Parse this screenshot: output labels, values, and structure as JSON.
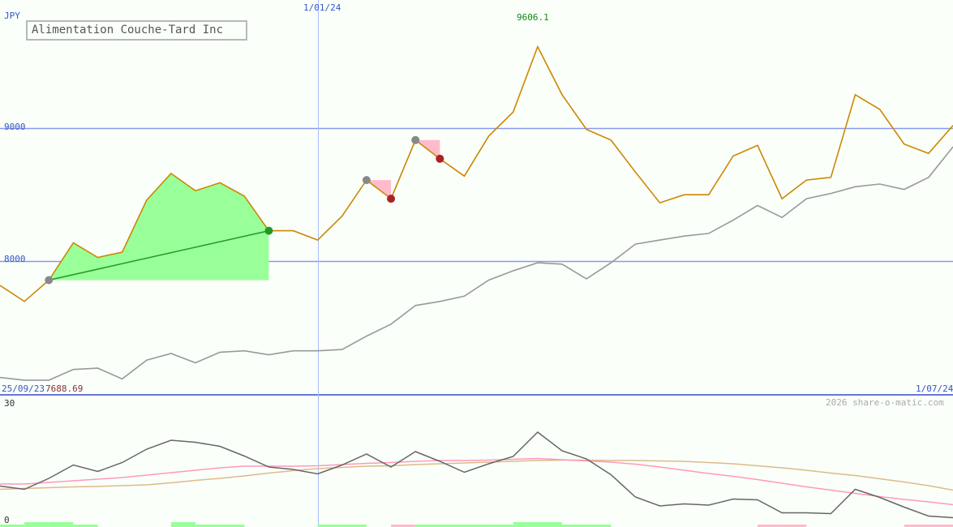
{
  "chart_data": [
    {
      "type": "line",
      "title": "Alimentation Couche-Tard Inc",
      "currency": "JPY",
      "x_start_label": "25/09/23",
      "x_mid_label": "1/01/24",
      "x_end_label": "1/07/24",
      "min_label": "7688.69",
      "max_label": "9606.1",
      "y_ticks": [
        8000,
        9000
      ],
      "ylim": [
        7000,
        9960
      ],
      "series": [
        {
          "color": "#cc8800",
          "values": [
            7820,
            7700,
            7860,
            8140,
            8030,
            8070,
            8460,
            8660,
            8530,
            8590,
            8490,
            8230,
            8230,
            8160,
            8340,
            8610,
            8470,
            8910,
            8770,
            8640,
            8940,
            9120,
            9610,
            9250,
            8990,
            8910,
            8670,
            8440,
            8500,
            8500,
            8790,
            8870,
            8470,
            8610,
            8630,
            9250,
            9140,
            8880,
            8810,
            9020
          ]
        },
        {
          "color": "#999999",
          "values": [
            7130,
            7110,
            7110,
            7190,
            7200,
            7120,
            7260,
            7310,
            7240,
            7320,
            7330,
            7300,
            7330,
            7330,
            7340,
            7440,
            7530,
            7670,
            7700,
            7740,
            7860,
            7930,
            7990,
            7980,
            7870,
            7990,
            8130,
            8160,
            8190,
            8210,
            8310,
            8420,
            8330,
            8470,
            8510,
            8560,
            8580,
            8540,
            8630,
            8860
          ]
        }
      ],
      "signals": [
        {
          "type": "buy",
          "from_index": 2,
          "to_index": 11
        },
        {
          "type": "sell",
          "from_index": 15,
          "to_index": 16
        },
        {
          "type": "sell",
          "from_index": 17,
          "to_index": 18
        }
      ]
    },
    {
      "type": "line",
      "y_ticks": [
        0,
        30
      ],
      "ylim": [
        0,
        30
      ],
      "series": [
        {
          "color": "#666666",
          "values": [
            9.7,
            8.9,
            11.6,
            14.9,
            13.3,
            15.5,
            18.8,
            21.0,
            20.5,
            19.5,
            17.1,
            14.4,
            13.8,
            12.7,
            14.9,
            17.6,
            14.4,
            18.2,
            15.8,
            13.1,
            15.2,
            17.0,
            23.0,
            18.4,
            16.4,
            12.5,
            7.0,
            4.8,
            5.3,
            5.0,
            6.5,
            6.3,
            3.1,
            3.1,
            2.9,
            8.9,
            6.9,
            4.5,
            2.3,
            1.9
          ]
        },
        {
          "color": "#ff99bb",
          "values": [
            10.2,
            10.2,
            10.6,
            11.0,
            11.4,
            11.8,
            12.4,
            13.0,
            13.6,
            14.2,
            14.6,
            14.6,
            14.6,
            14.7,
            15.0,
            15.3,
            15.5,
            15.8,
            16.0,
            16.0,
            16.1,
            16.3,
            16.5,
            16.2,
            15.9,
            15.6,
            15.1,
            14.4,
            13.6,
            12.8,
            12.1,
            11.3,
            10.4,
            9.5,
            8.7,
            7.9,
            7.1,
            6.4,
            5.8,
            5.1
          ]
        },
        {
          "color": "#ddbb88",
          "values": [
            8.9,
            9.1,
            9.3,
            9.5,
            9.6,
            9.8,
            10.0,
            10.5,
            11.1,
            11.6,
            12.2,
            12.9,
            13.5,
            14.0,
            14.3,
            14.6,
            14.7,
            15.0,
            15.2,
            15.4,
            15.6,
            15.8,
            16.0,
            16.1,
            16.1,
            16.0,
            16.0,
            15.9,
            15.8,
            15.5,
            15.2,
            14.7,
            14.2,
            13.6,
            12.9,
            12.3,
            11.5,
            10.7,
            9.8,
            8.7
          ]
        }
      ],
      "bars_positive_color": "#99ff99",
      "bars_negative_color": "#ffbbcc",
      "bars": [
        1,
        2,
        2,
        1,
        0,
        0,
        0,
        2,
        1,
        1,
        0,
        0,
        0,
        1,
        1,
        0,
        -1,
        1,
        1,
        1,
        1,
        2,
        2,
        1,
        1,
        0,
        0,
        0,
        0,
        0,
        0,
        -1,
        -1,
        0,
        0,
        0,
        0,
        -1,
        -1,
        0
      ]
    }
  ],
  "footer": {
    "copyright": "2026 share-o-matic.com"
  }
}
